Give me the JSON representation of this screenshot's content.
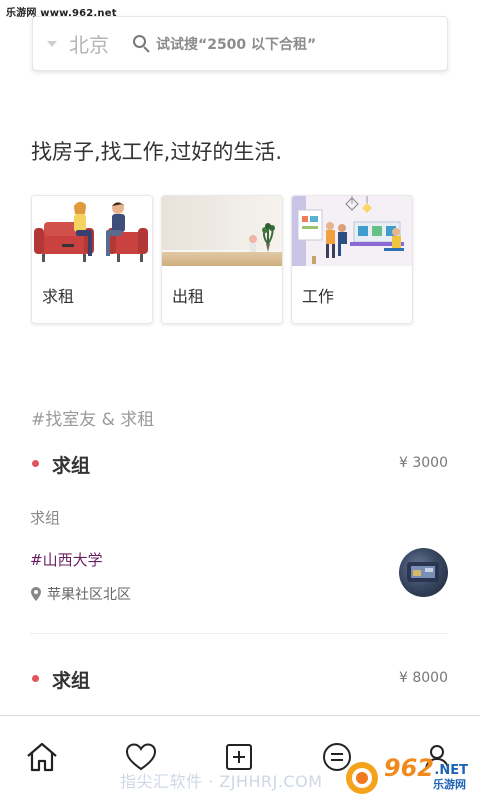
{
  "watermark": {
    "top": "乐游网 www.962.net",
    "bottom": "指尖汇软件 · ZJHHRJ.COM"
  },
  "search": {
    "city": "北京",
    "placeholder": "试试搜“2500 以下合租”"
  },
  "tagline": "找房子,找工作,过好的生活.",
  "categories": [
    {
      "label": "求租",
      "icon": "couple-on-sofa-illustration"
    },
    {
      "label": "出租",
      "icon": "empty-room-illustration"
    },
    {
      "label": "工作",
      "icon": "office-team-illustration"
    }
  ],
  "section_title": "#找室友 & 求租",
  "listings": [
    {
      "title": "求组",
      "price": "¥ 3000",
      "description": "求组",
      "tag": "#山西大学",
      "location": "苹果社区北区"
    },
    {
      "title": "求组",
      "price": "¥ 8000"
    }
  ],
  "bottom_nav": [
    {
      "name": "home",
      "icon": "home-icon"
    },
    {
      "name": "favorites",
      "icon": "heart-icon"
    },
    {
      "name": "post",
      "icon": "add-square-icon"
    },
    {
      "name": "messages",
      "icon": "message-icon"
    },
    {
      "name": "profile",
      "icon": "person-icon"
    }
  ],
  "logo": {
    "number": "962",
    "suffix": ".NET",
    "caption": "乐游网"
  },
  "colors": {
    "accent_dot": "#e0525c",
    "tag": "#6b2060",
    "text": "#333333"
  }
}
